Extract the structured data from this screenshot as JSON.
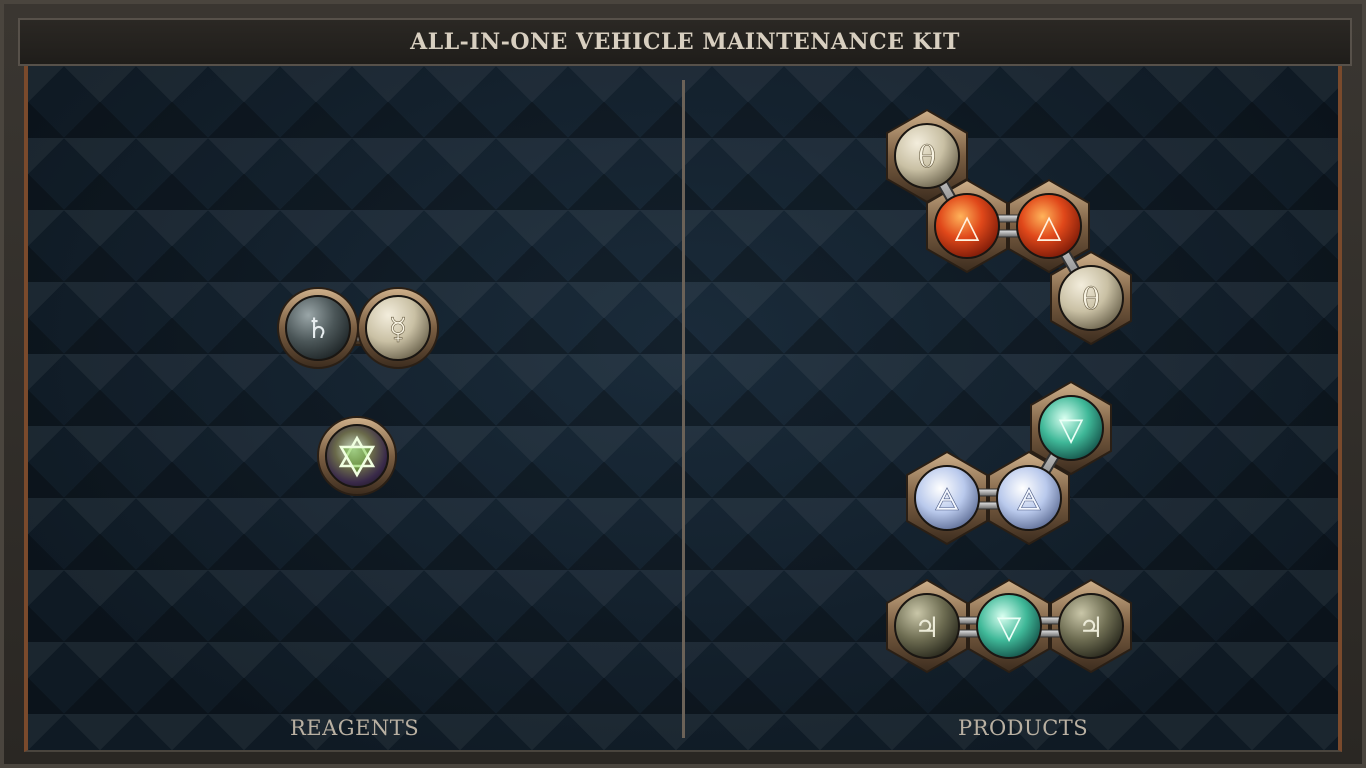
{
  "window": {
    "title": "ALL-IN-ONE VEHICLE MAINTENANCE KIT"
  },
  "sections": {
    "reagents_label": "REAGENTS",
    "products_label": "PRODUCTS"
  },
  "colors": {
    "accent_copper": "#7a4a2c",
    "board_navy": "#13202c",
    "text_light": "#d8cfc0"
  },
  "reagents": [
    {
      "id": "reagent-1",
      "atoms": [
        {
          "element": "saturn",
          "glyph": "♄",
          "color": "slate"
        },
        {
          "element": "mercury",
          "glyph": "☿",
          "color": "cream"
        }
      ]
    },
    {
      "id": "reagent-2",
      "atoms": [
        {
          "element": "quintessence",
          "glyph": "✡",
          "color": "iridescent"
        }
      ]
    }
  ],
  "products": [
    {
      "id": "product-1",
      "atoms": [
        {
          "element": "salt",
          "glyph": "θ",
          "color": "cream"
        },
        {
          "element": "fire",
          "glyph": "△",
          "color": "red"
        },
        {
          "element": "fire",
          "glyph": "△",
          "color": "red"
        },
        {
          "element": "salt",
          "glyph": "θ",
          "color": "cream"
        }
      ]
    },
    {
      "id": "product-2",
      "atoms": [
        {
          "element": "air",
          "glyph": "🜁",
          "color": "pale-blue"
        },
        {
          "element": "air",
          "glyph": "🜁",
          "color": "pale-blue"
        },
        {
          "element": "water",
          "glyph": "▽",
          "color": "teal"
        }
      ]
    },
    {
      "id": "product-3",
      "atoms": [
        {
          "element": "tin",
          "glyph": "♃",
          "color": "olive"
        },
        {
          "element": "water",
          "glyph": "▽",
          "color": "teal"
        },
        {
          "element": "tin",
          "glyph": "♃",
          "color": "olive"
        }
      ]
    }
  ]
}
